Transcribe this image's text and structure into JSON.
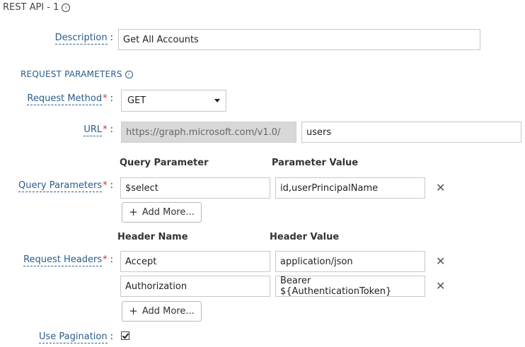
{
  "header": {
    "title": "REST API - 1"
  },
  "description": {
    "label": "Description",
    "value": "Get All Accounts"
  },
  "section": {
    "title": "REQUEST PARAMETERS"
  },
  "request_method": {
    "label": "Request Method",
    "value": "GET"
  },
  "url": {
    "label": "URL",
    "base": "https://graph.microsoft.com/v1.0/",
    "path": "users"
  },
  "query_parameters": {
    "label": "Query Parameters",
    "col_name": "Query Parameter",
    "col_value": "Parameter Value",
    "rows": [
      {
        "name": "$select",
        "value": "id,userPrincipalName"
      }
    ],
    "add_more": "Add More..."
  },
  "request_headers": {
    "label": "Request Headers",
    "col_name": "Header Name",
    "col_value": "Header Value",
    "rows": [
      {
        "name": "Accept",
        "value": "application/json"
      },
      {
        "name": "Authorization",
        "value": "Bearer ${AuthenticationToken}"
      }
    ],
    "add_more": "Add More..."
  },
  "pagination": {
    "label": "Use Pagination",
    "checked": true
  },
  "common": {
    "required_mark": "*",
    "colon": ":"
  },
  "icons": {
    "remove": "close-icon",
    "add": "plus-icon",
    "expand": "circle-arrow-icon"
  }
}
